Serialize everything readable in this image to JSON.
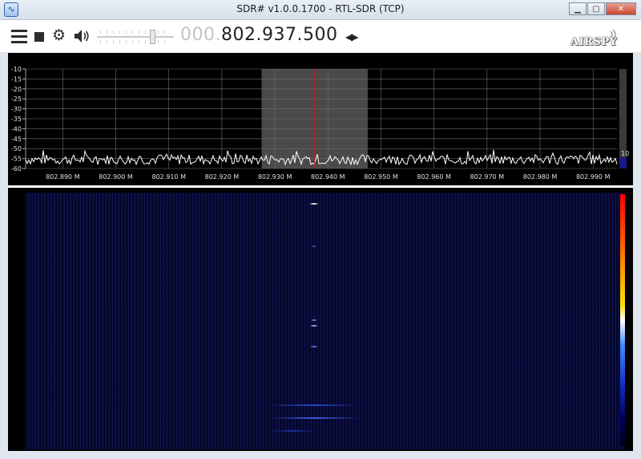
{
  "window": {
    "title": "SDR# v1.0.0.1700 - RTL-SDR (TCP)",
    "minimize_label": "▁",
    "maximize_label": "▢",
    "close_label": "✕"
  },
  "toolbar": {
    "menu_icon": "menu-icon",
    "stop_icon": "stop-icon",
    "settings_icon": "gear-icon",
    "audio_icon": "speaker-icon",
    "frequency_dim": "000.",
    "frequency_bright": "802.937.500",
    "frequency_arrows": "◀▶",
    "logo": "AIRSPY"
  },
  "spectrum": {
    "y_ticks": [
      "-10",
      "-15",
      "-20",
      "-25",
      "-30",
      "-35",
      "-40",
      "-45",
      "-50",
      "-55",
      "-60"
    ],
    "x_ticks": [
      "802.890 M",
      "802.900 M",
      "802.910 M",
      "802.920 M",
      "802.930 M",
      "802.940 M",
      "802.950 M",
      "802.960 M",
      "802.970 M",
      "802.980 M",
      "802.990 M"
    ],
    "x_tick_values": [
      802.89,
      802.9,
      802.91,
      802.92,
      802.93,
      802.94,
      802.95,
      802.96,
      802.97,
      802.98,
      802.99
    ],
    "center_frequency_mhz": 802.9375,
    "filter_start_mhz": 802.9275,
    "filter_end_mhz": 802.9475,
    "x_range_mhz": [
      802.883,
      802.9945
    ],
    "y_range_db": [
      -60,
      -10
    ],
    "noise_floor_db": -55.5,
    "contrast_value": "10",
    "colors": {
      "background": "#000000",
      "grid": "#6e6e6e",
      "trace": "#ffffff",
      "filter": "#4a4a4a",
      "center": "#d01818"
    }
  },
  "waterfall": {
    "colors": {
      "background": "#05061f",
      "signal": "#ffffff"
    }
  }
}
